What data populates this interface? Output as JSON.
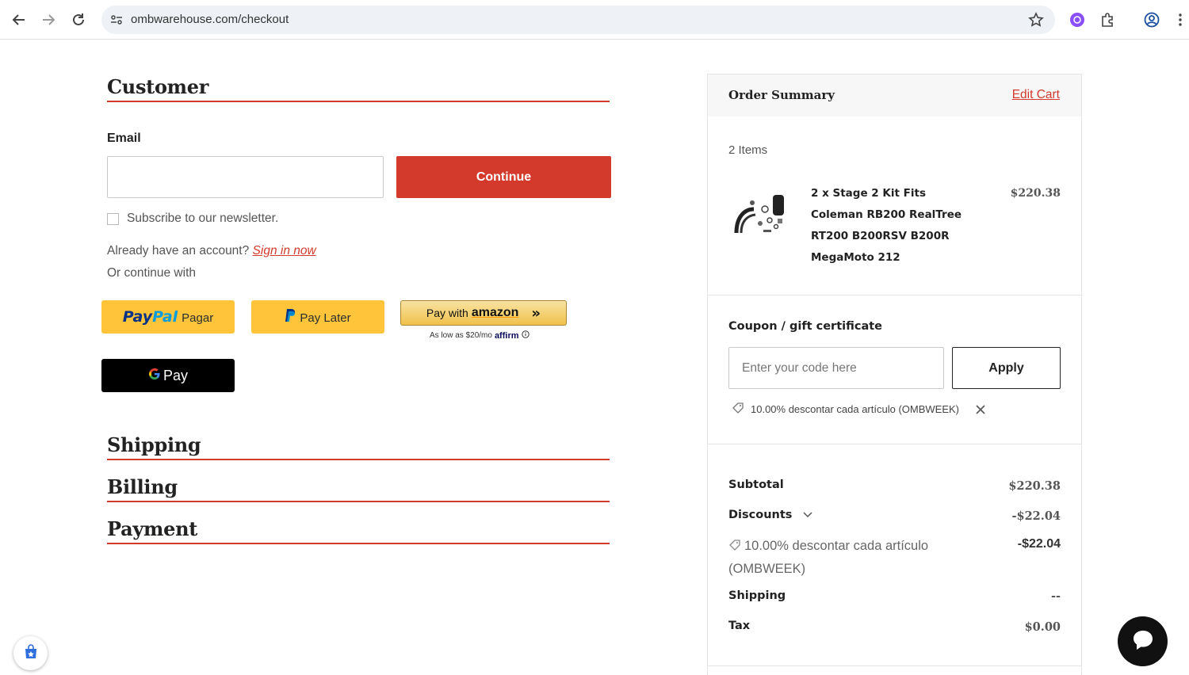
{
  "browser": {
    "url": "ombwarehouse.com/checkout"
  },
  "checkout": {
    "customer_title": "Customer",
    "email_label": "Email",
    "email_value": "",
    "continue_label": "Continue",
    "newsletter_label": "Subscribe to our newsletter.",
    "already_account": "Already have an account?",
    "sign_in_label": "Sign in now",
    "or_continue": "Or continue with",
    "paypal_pay": "Pay",
    "paypal_pal": "Pal",
    "paypal_sub": "Pagar",
    "paylater_label": "Pay Later",
    "amazon_text": "Pay with",
    "amazon_logo": "amazon",
    "affirm_text": "As low as $20/mo",
    "affirm_logo": "affirm",
    "gpay_label": "Pay",
    "shipping_title": "Shipping",
    "billing_title": "Billing",
    "payment_title": "Payment"
  },
  "summary": {
    "title": "Order Summary",
    "edit_cart": "Edit Cart",
    "items_count": "2 Items",
    "product_name": "2 x Stage 2 Kit Fits Coleman RB200 RealTree RT200 B200RSV B200R MegaMoto 212",
    "product_price": "$220.38",
    "coupon_label": "Coupon / gift certificate",
    "coupon_placeholder": "Enter your code here",
    "apply_label": "Apply",
    "applied_coupon": "10.00% descontar cada artículo (OMBWEEK)",
    "subtotal_label": "Subtotal",
    "subtotal_value": "$220.38",
    "discounts_label": "Discounts",
    "discounts_value": "-$22.04",
    "discount_detail": "10.00% descontar cada artículo (OMBWEEK)",
    "discount_detail_value": "-$22.04",
    "shipping_label": "Shipping",
    "shipping_value": "--",
    "tax_label": "Tax",
    "tax_value": "$0.00"
  },
  "colors": {
    "accent": "#d33a2c",
    "paypal_yellow": "#ffc439"
  }
}
